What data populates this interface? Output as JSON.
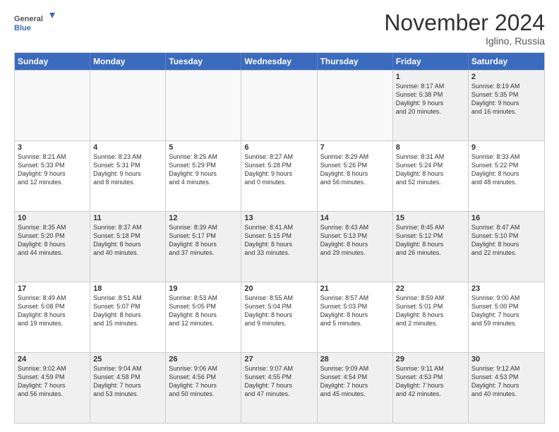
{
  "logo": {
    "line1": "General",
    "line2": "Blue"
  },
  "title": "November 2024",
  "subtitle": "Iglino, Russia",
  "header_days": [
    "Sunday",
    "Monday",
    "Tuesday",
    "Wednesday",
    "Thursday",
    "Friday",
    "Saturday"
  ],
  "rows": [
    [
      {
        "day": "",
        "lines": []
      },
      {
        "day": "",
        "lines": []
      },
      {
        "day": "",
        "lines": []
      },
      {
        "day": "",
        "lines": []
      },
      {
        "day": "",
        "lines": []
      },
      {
        "day": "1",
        "lines": [
          "Sunrise: 8:17 AM",
          "Sunset: 5:38 PM",
          "Daylight: 9 hours",
          "and 20 minutes."
        ]
      },
      {
        "day": "2",
        "lines": [
          "Sunrise: 8:19 AM",
          "Sunset: 5:35 PM",
          "Daylight: 9 hours",
          "and 16 minutes."
        ]
      }
    ],
    [
      {
        "day": "3",
        "lines": [
          "Sunrise: 8:21 AM",
          "Sunset: 5:33 PM",
          "Daylight: 9 hours",
          "and 12 minutes."
        ]
      },
      {
        "day": "4",
        "lines": [
          "Sunrise: 8:23 AM",
          "Sunset: 5:31 PM",
          "Daylight: 9 hours",
          "and 8 minutes."
        ]
      },
      {
        "day": "5",
        "lines": [
          "Sunrise: 8:25 AM",
          "Sunset: 5:29 PM",
          "Daylight: 9 hours",
          "and 4 minutes."
        ]
      },
      {
        "day": "6",
        "lines": [
          "Sunrise: 8:27 AM",
          "Sunset: 5:28 PM",
          "Daylight: 9 hours",
          "and 0 minutes."
        ]
      },
      {
        "day": "7",
        "lines": [
          "Sunrise: 8:29 AM",
          "Sunset: 5:26 PM",
          "Daylight: 8 hours",
          "and 56 minutes."
        ]
      },
      {
        "day": "8",
        "lines": [
          "Sunrise: 8:31 AM",
          "Sunset: 5:24 PM",
          "Daylight: 8 hours",
          "and 52 minutes."
        ]
      },
      {
        "day": "9",
        "lines": [
          "Sunrise: 8:33 AM",
          "Sunset: 5:22 PM",
          "Daylight: 8 hours",
          "and 48 minutes."
        ]
      }
    ],
    [
      {
        "day": "10",
        "lines": [
          "Sunrise: 8:35 AM",
          "Sunset: 5:20 PM",
          "Daylight: 8 hours",
          "and 44 minutes."
        ]
      },
      {
        "day": "11",
        "lines": [
          "Sunrise: 8:37 AM",
          "Sunset: 5:18 PM",
          "Daylight: 8 hours",
          "and 40 minutes."
        ]
      },
      {
        "day": "12",
        "lines": [
          "Sunrise: 8:39 AM",
          "Sunset: 5:17 PM",
          "Daylight: 8 hours",
          "and 37 minutes."
        ]
      },
      {
        "day": "13",
        "lines": [
          "Sunrise: 8:41 AM",
          "Sunset: 5:15 PM",
          "Daylight: 8 hours",
          "and 33 minutes."
        ]
      },
      {
        "day": "14",
        "lines": [
          "Sunrise: 8:43 AM",
          "Sunset: 5:13 PM",
          "Daylight: 8 hours",
          "and 29 minutes."
        ]
      },
      {
        "day": "15",
        "lines": [
          "Sunrise: 8:45 AM",
          "Sunset: 5:12 PM",
          "Daylight: 8 hours",
          "and 26 minutes."
        ]
      },
      {
        "day": "16",
        "lines": [
          "Sunrise: 8:47 AM",
          "Sunset: 5:10 PM",
          "Daylight: 8 hours",
          "and 22 minutes."
        ]
      }
    ],
    [
      {
        "day": "17",
        "lines": [
          "Sunrise: 8:49 AM",
          "Sunset: 5:08 PM",
          "Daylight: 8 hours",
          "and 19 minutes."
        ]
      },
      {
        "day": "18",
        "lines": [
          "Sunrise: 8:51 AM",
          "Sunset: 5:07 PM",
          "Daylight: 8 hours",
          "and 15 minutes."
        ]
      },
      {
        "day": "19",
        "lines": [
          "Sunrise: 8:53 AM",
          "Sunset: 5:05 PM",
          "Daylight: 8 hours",
          "and 12 minutes."
        ]
      },
      {
        "day": "20",
        "lines": [
          "Sunrise: 8:55 AM",
          "Sunset: 5:04 PM",
          "Daylight: 8 hours",
          "and 9 minutes."
        ]
      },
      {
        "day": "21",
        "lines": [
          "Sunrise: 8:57 AM",
          "Sunset: 5:03 PM",
          "Daylight: 8 hours",
          "and 5 minutes."
        ]
      },
      {
        "day": "22",
        "lines": [
          "Sunrise: 8:59 AM",
          "Sunset: 5:01 PM",
          "Daylight: 8 hours",
          "and 2 minutes."
        ]
      },
      {
        "day": "23",
        "lines": [
          "Sunrise: 9:00 AM",
          "Sunset: 5:00 PM",
          "Daylight: 7 hours",
          "and 59 minutes."
        ]
      }
    ],
    [
      {
        "day": "24",
        "lines": [
          "Sunrise: 9:02 AM",
          "Sunset: 4:59 PM",
          "Daylight: 7 hours",
          "and 56 minutes."
        ]
      },
      {
        "day": "25",
        "lines": [
          "Sunrise: 9:04 AM",
          "Sunset: 4:58 PM",
          "Daylight: 7 hours",
          "and 53 minutes."
        ]
      },
      {
        "day": "26",
        "lines": [
          "Sunrise: 9:06 AM",
          "Sunset: 4:56 PM",
          "Daylight: 7 hours",
          "and 50 minutes."
        ]
      },
      {
        "day": "27",
        "lines": [
          "Sunrise: 9:07 AM",
          "Sunset: 4:55 PM",
          "Daylight: 7 hours",
          "and 47 minutes."
        ]
      },
      {
        "day": "28",
        "lines": [
          "Sunrise: 9:09 AM",
          "Sunset: 4:54 PM",
          "Daylight: 7 hours",
          "and 45 minutes."
        ]
      },
      {
        "day": "29",
        "lines": [
          "Sunrise: 9:11 AM",
          "Sunset: 4:53 PM",
          "Daylight: 7 hours",
          "and 42 minutes."
        ]
      },
      {
        "day": "30",
        "lines": [
          "Sunrise: 9:12 AM",
          "Sunset: 4:53 PM",
          "Daylight: 7 hours",
          "and 40 minutes."
        ]
      }
    ]
  ]
}
